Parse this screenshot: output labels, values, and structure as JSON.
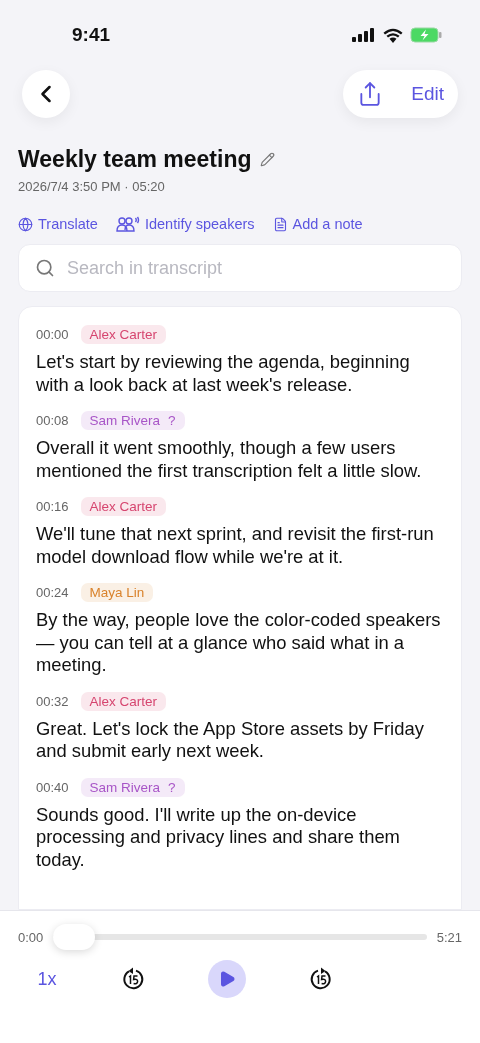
{
  "status_bar": {
    "time": "9:41"
  },
  "nav": {
    "edit_label": "Edit"
  },
  "title": "Weekly team meeting",
  "meta": "2026/7/4 3:50 PM · 05:20",
  "actions": [
    {
      "kind": "translate",
      "label": "Translate"
    },
    {
      "kind": "speakers",
      "label": "Identify speakers"
    },
    {
      "kind": "note",
      "label": "Add a note"
    }
  ],
  "search": {
    "placeholder": "Search in transcript"
  },
  "segments": [
    {
      "time": "00:00",
      "speaker": "Alex Carter",
      "color": "#d6456f",
      "unconfirmed": false,
      "text": "Let's start by reviewing the agenda, beginning with a look back at last week's release."
    },
    {
      "time": "00:08",
      "speaker": "Sam Rivera",
      "color": "#a855c7",
      "unconfirmed": true,
      "flag": "?",
      "text": "Overall it went smoothly, though a few users mentioned the first transcription felt a little slow."
    },
    {
      "time": "00:16",
      "speaker": "Alex Carter",
      "color": "#d6456f",
      "unconfirmed": false,
      "text": "We'll tune that next sprint, and revisit the first-run model download flow while we're at it."
    },
    {
      "time": "00:24",
      "speaker": "Maya Lin",
      "color": "#d9822b",
      "unconfirmed": false,
      "text": "By the way, people love the color-coded speakers — you can tell at a glance who said what in a meeting."
    },
    {
      "time": "00:32",
      "speaker": "Alex Carter",
      "color": "#d6456f",
      "unconfirmed": false,
      "text": "Great. Let's lock the App Store assets by Friday and submit early next week."
    },
    {
      "time": "00:40",
      "speaker": "Sam Rivera",
      "color": "#a855c7",
      "unconfirmed": true,
      "flag": "?",
      "text": "Sounds good. I'll write up the on-device processing and privacy lines and share them today."
    }
  ],
  "player": {
    "elapsed": "0:00",
    "total": "5:21",
    "level": 0,
    "speed": "1x",
    "playing": false
  }
}
